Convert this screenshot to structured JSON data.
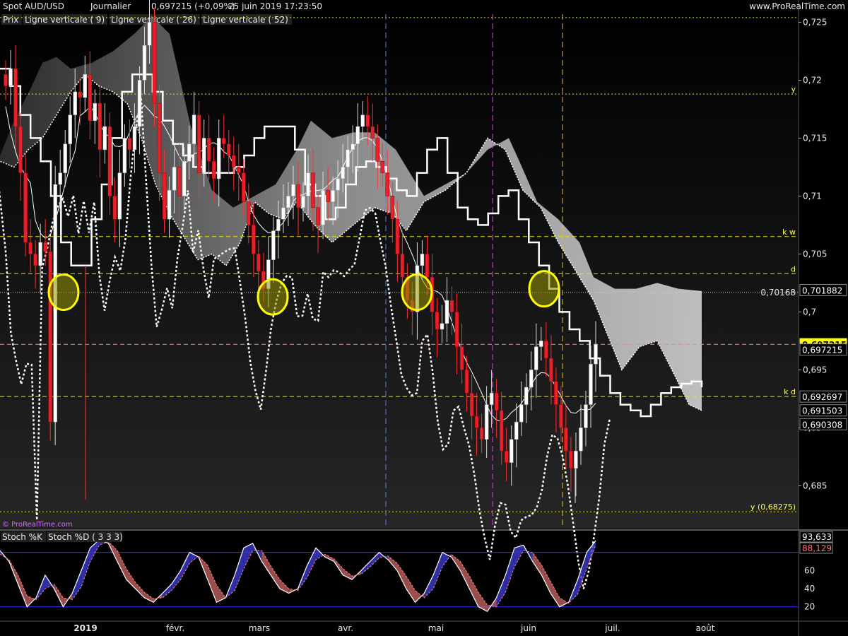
{
  "header": {
    "instrument": "Spot AUD/USD",
    "period": "Journalier",
    "last_quote": "0,697215 (+0,09%)",
    "datetime": "25 juin 2019 17:23:50",
    "site": "www.ProRealTime.com"
  },
  "legend": {
    "price": "Prix",
    "vline9": "Ligne verticale ( 9)",
    "vline26": "Ligne verticale ( 26)",
    "vline52": "Ligne verticale ( 52)"
  },
  "watermark": "© ProRealTime.com",
  "stoch_legend": {
    "k": "Stoch %K",
    "d": "Stoch %D ( 3 3 3)"
  },
  "colors": {
    "bull": "#ffffff",
    "bear": "#e8202a",
    "level": "#e6e600",
    "vline9": "#e0c020",
    "vline26": "#e040e0",
    "vline52": "#5a80e0",
    "circle": "#ffff00",
    "stoch_k": "#3030ff",
    "stoch_d": "#e06060"
  },
  "chart_data": [
    {
      "type": "candlestick",
      "title": "Spot AUD/USD",
      "ylim": [
        0.6813,
        0.7257
      ],
      "y_ticks": [
        "0,725",
        "0,72",
        "0,715",
        "0,71",
        "0,705",
        "0,7",
        "0,695",
        "0,69",
        "0,685"
      ],
      "y_tick_values": [
        0.725,
        0.72,
        0.715,
        0.71,
        0.705,
        0.7,
        0.695,
        0.69,
        0.685
      ],
      "months": [
        "2019",
        "févr.",
        "mars",
        "avr.",
        "mai",
        "juin",
        "juil.",
        "août"
      ],
      "levels": [
        {
          "label": "y",
          "value": 0.7188
        },
        {
          "label": "k w",
          "value": 0.7065
        },
        {
          "label": "d",
          "value": 0.7033
        },
        {
          "label": "k d",
          "value": 0.6927
        },
        {
          "label": "y (0,68275)",
          "value": 0.68275
        }
      ],
      "price_tags": [
        {
          "text": "0,701882",
          "value": 0.701882
        },
        {
          "text": "0,70168",
          "value": 0.70168
        },
        {
          "text": "0,697215",
          "value": 0.697215
        },
        {
          "text": "0,697215",
          "value": 0.69675
        },
        {
          "text": "0,692697",
          "value": 0.692697
        },
        {
          "text": "0,691503",
          "value": 0.691503
        },
        {
          "text": "0,690308",
          "value": 0.690308
        }
      ],
      "candles_close": [
        0.7195,
        0.721,
        0.716,
        0.712,
        0.706,
        0.705,
        0.704,
        0.706,
        0.7052,
        0.6905,
        0.711,
        0.712,
        0.7145,
        0.717,
        0.719,
        0.7185,
        0.7205,
        0.7165,
        0.718,
        0.714,
        0.716,
        0.71,
        0.708,
        0.712,
        0.715,
        0.714,
        0.716,
        0.72,
        0.723,
        0.725,
        0.718,
        0.712,
        0.708,
        0.7105,
        0.7125,
        0.71,
        0.713,
        0.7145,
        0.717,
        0.712,
        0.715,
        0.713,
        0.7115,
        0.715,
        0.7145,
        0.7135,
        0.7125,
        0.712,
        0.7095,
        0.7075,
        0.705,
        0.7035,
        0.702,
        0.7045,
        0.707,
        0.708,
        0.709,
        0.71,
        0.711,
        0.709,
        0.71,
        0.712,
        0.709,
        0.7075,
        0.7105,
        0.7095,
        0.7105,
        0.7115,
        0.7125,
        0.714,
        0.7145,
        0.716,
        0.717,
        0.716,
        0.715,
        0.713,
        0.712,
        0.71,
        0.708,
        0.705,
        0.703,
        0.701,
        0.7,
        0.704,
        0.705,
        0.703,
        0.7,
        0.6985,
        0.699,
        0.701,
        0.7,
        0.697,
        0.695,
        0.693,
        0.691,
        0.69,
        0.689,
        0.692,
        0.693,
        0.6915,
        0.688,
        0.687,
        0.689,
        0.6905,
        0.692,
        0.6935,
        0.695,
        0.697,
        0.6975,
        0.696,
        0.694,
        0.692,
        0.69,
        0.688,
        0.6865,
        0.688,
        0.69,
        0.692,
        0.6955,
        0.6972
      ],
      "tenkan": [
        0.721,
        0.7195,
        0.717,
        0.715,
        0.713,
        0.71,
        0.706,
        0.704,
        0.704,
        0.708,
        0.711,
        0.715,
        0.719,
        0.7205,
        0.7205,
        0.719,
        0.7165,
        0.7145,
        0.7135,
        0.7125,
        0.712,
        0.712,
        0.712,
        0.7125,
        0.7135,
        0.715,
        0.716,
        0.716,
        0.716,
        0.714,
        0.711,
        0.71,
        0.708,
        0.709,
        0.711,
        0.7125,
        0.713,
        0.7125,
        0.7115,
        0.7105,
        0.71,
        0.712,
        0.714,
        0.715,
        0.712,
        0.709,
        0.708,
        0.7075,
        0.7085,
        0.71,
        0.7105,
        0.708,
        0.706,
        0.704,
        0.702,
        0.7,
        0.6985,
        0.6975,
        0.696,
        0.6945,
        0.693,
        0.692,
        0.6915,
        0.691,
        0.692,
        0.693,
        0.6935,
        0.6938,
        0.694,
        0.6935
      ],
      "stoch_k": [
        82,
        70,
        45,
        20,
        30,
        55,
        40,
        20,
        35,
        60,
        85,
        94,
        90,
        70,
        50,
        40,
        30,
        25,
        35,
        45,
        60,
        80,
        75,
        50,
        25,
        30,
        55,
        85,
        90,
        70,
        55,
        40,
        35,
        40,
        65,
        85,
        75,
        70,
        55,
        50,
        60,
        70,
        80,
        72,
        60,
        40,
        25,
        35,
        55,
        80,
        75,
        60,
        40,
        20,
        15,
        30,
        55,
        85,
        88,
        70,
        55,
        35,
        20,
        25,
        50,
        80,
        93
      ],
      "stoch_d": [
        78,
        72,
        55,
        32,
        28,
        40,
        45,
        30,
        28,
        42,
        70,
        88,
        92,
        82,
        62,
        47,
        36,
        29,
        30,
        38,
        50,
        68,
        76,
        66,
        44,
        30,
        38,
        62,
        82,
        82,
        65,
        50,
        40,
        38,
        52,
        72,
        78,
        73,
        62,
        54,
        56,
        64,
        74,
        76,
        68,
        54,
        38,
        30,
        40,
        64,
        78,
        70,
        54,
        36,
        22,
        20,
        36,
        64,
        82,
        80,
        66,
        48,
        30,
        24,
        34,
        62,
        88
      ],
      "stoch_levels": [
        80,
        20
      ],
      "stoch_ticks": [
        "60",
        "40",
        "20"
      ],
      "stoch_tick_values": [
        60,
        40,
        20
      ],
      "stoch_tags": [
        {
          "text": "93,633",
          "value": 93.633
        },
        {
          "text": "88,129",
          "value": 88.129
        }
      ]
    }
  ]
}
